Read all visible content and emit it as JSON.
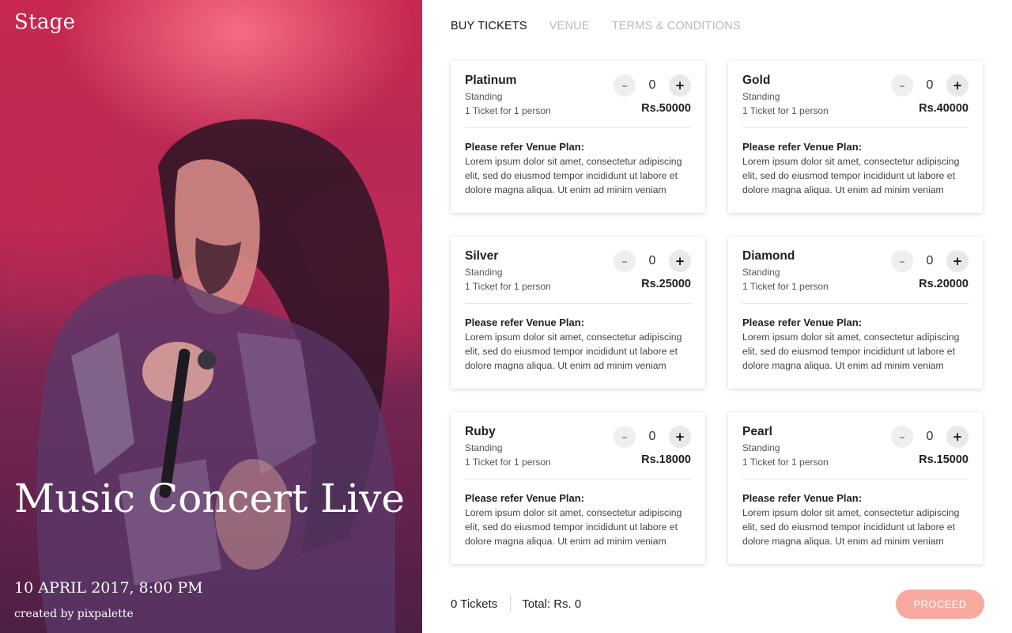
{
  "hero": {
    "brand": "Stage",
    "title": "Music Concert Live",
    "date": "10 APRIL 2017, 8:00 PM",
    "credit": "created by pixpalette"
  },
  "tabs": [
    {
      "label": "BUY TICKETS",
      "active": true
    },
    {
      "label": "VENUE",
      "active": false
    },
    {
      "label": "TERMS & CONDITIONS",
      "active": false
    }
  ],
  "tickets": [
    {
      "name": "Platinum",
      "type": "Standing",
      "note": "1 Ticket for 1 person",
      "price": "Rs.50000",
      "qty": "0",
      "minus": "–",
      "plus": "+",
      "desc_head": "Please refer Venue Plan:",
      "desc": "Lorem ipsum dolor sit amet, consectetur adipiscing elit, sed do eiusmod tempor incididunt ut labore et dolore magna aliqua. Ut enim ad minim veniam"
    },
    {
      "name": "Gold",
      "type": "Standing",
      "note": "1 Ticket for 1 person",
      "price": "Rs.40000",
      "qty": "0",
      "minus": "–",
      "plus": "+",
      "desc_head": "Please refer Venue Plan:",
      "desc": "Lorem ipsum dolor sit amet, consectetur adipiscing elit, sed do eiusmod tempor incididunt ut labore et dolore magna aliqua. Ut enim ad minim veniam"
    },
    {
      "name": "Silver",
      "type": "Standing",
      "note": "1 Ticket for 1 person",
      "price": "Rs.25000",
      "qty": "0",
      "minus": "–",
      "plus": "+",
      "desc_head": "Please refer Venue Plan:",
      "desc": "Lorem ipsum dolor sit amet, consectetur adipiscing elit, sed do eiusmod tempor incididunt ut labore et dolore magna aliqua. Ut enim ad minim veniam"
    },
    {
      "name": "Diamond",
      "type": "Standing",
      "note": "1 Ticket for 1 person",
      "price": "Rs.20000",
      "qty": "0",
      "minus": "–",
      "plus": "+",
      "desc_head": "Please refer Venue Plan:",
      "desc": "Lorem ipsum dolor sit amet, consectetur adipiscing elit, sed do eiusmod tempor incididunt ut labore et dolore magna aliqua. Ut enim ad minim veniam"
    },
    {
      "name": "Ruby",
      "type": "Standing",
      "note": "1 Ticket for 1 person",
      "price": "Rs.18000",
      "qty": "0",
      "minus": "–",
      "plus": "+",
      "desc_head": "Please refer Venue Plan:",
      "desc": "Lorem ipsum dolor sit amet, consectetur adipiscing elit, sed do eiusmod tempor incididunt ut labore et dolore magna aliqua. Ut enim ad minim veniam"
    },
    {
      "name": "Pearl",
      "type": "Standing",
      "note": "1 Ticket for 1 person",
      "price": "Rs.15000",
      "qty": "0",
      "minus": "–",
      "plus": "+",
      "desc_head": "Please refer Venue Plan:",
      "desc": "Lorem ipsum dolor sit amet, consectetur adipiscing elit, sed do eiusmod tempor incididunt ut labore et dolore magna aliqua. Ut enim ad minim veniam"
    }
  ],
  "footer": {
    "count": "0 Tickets",
    "total": "Total: Rs. 0",
    "proceed": "PROCEED"
  },
  "colors": {
    "accent": "#f7a9a0",
    "hero_top": "#c8284f",
    "hero_bottom": "#4e1f45"
  }
}
